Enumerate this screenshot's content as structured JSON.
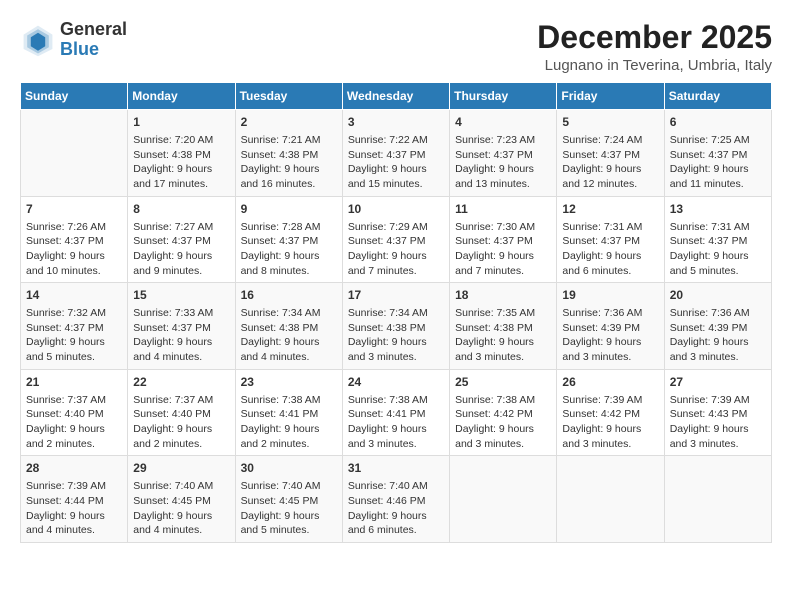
{
  "logo": {
    "general": "General",
    "blue": "Blue"
  },
  "title": "December 2025",
  "location": "Lugnano in Teverina, Umbria, Italy",
  "days_of_week": [
    "Sunday",
    "Monday",
    "Tuesday",
    "Wednesday",
    "Thursday",
    "Friday",
    "Saturday"
  ],
  "weeks": [
    [
      {
        "day": "",
        "content": ""
      },
      {
        "day": "1",
        "content": "Sunrise: 7:20 AM\nSunset: 4:38 PM\nDaylight: 9 hours\nand 17 minutes."
      },
      {
        "day": "2",
        "content": "Sunrise: 7:21 AM\nSunset: 4:38 PM\nDaylight: 9 hours\nand 16 minutes."
      },
      {
        "day": "3",
        "content": "Sunrise: 7:22 AM\nSunset: 4:37 PM\nDaylight: 9 hours\nand 15 minutes."
      },
      {
        "day": "4",
        "content": "Sunrise: 7:23 AM\nSunset: 4:37 PM\nDaylight: 9 hours\nand 13 minutes."
      },
      {
        "day": "5",
        "content": "Sunrise: 7:24 AM\nSunset: 4:37 PM\nDaylight: 9 hours\nand 12 minutes."
      },
      {
        "day": "6",
        "content": "Sunrise: 7:25 AM\nSunset: 4:37 PM\nDaylight: 9 hours\nand 11 minutes."
      }
    ],
    [
      {
        "day": "7",
        "content": "Sunrise: 7:26 AM\nSunset: 4:37 PM\nDaylight: 9 hours\nand 10 minutes."
      },
      {
        "day": "8",
        "content": "Sunrise: 7:27 AM\nSunset: 4:37 PM\nDaylight: 9 hours\nand 9 minutes."
      },
      {
        "day": "9",
        "content": "Sunrise: 7:28 AM\nSunset: 4:37 PM\nDaylight: 9 hours\nand 8 minutes."
      },
      {
        "day": "10",
        "content": "Sunrise: 7:29 AM\nSunset: 4:37 PM\nDaylight: 9 hours\nand 7 minutes."
      },
      {
        "day": "11",
        "content": "Sunrise: 7:30 AM\nSunset: 4:37 PM\nDaylight: 9 hours\nand 7 minutes."
      },
      {
        "day": "12",
        "content": "Sunrise: 7:31 AM\nSunset: 4:37 PM\nDaylight: 9 hours\nand 6 minutes."
      },
      {
        "day": "13",
        "content": "Sunrise: 7:31 AM\nSunset: 4:37 PM\nDaylight: 9 hours\nand 5 minutes."
      }
    ],
    [
      {
        "day": "14",
        "content": "Sunrise: 7:32 AM\nSunset: 4:37 PM\nDaylight: 9 hours\nand 5 minutes."
      },
      {
        "day": "15",
        "content": "Sunrise: 7:33 AM\nSunset: 4:37 PM\nDaylight: 9 hours\nand 4 minutes."
      },
      {
        "day": "16",
        "content": "Sunrise: 7:34 AM\nSunset: 4:38 PM\nDaylight: 9 hours\nand 4 minutes."
      },
      {
        "day": "17",
        "content": "Sunrise: 7:34 AM\nSunset: 4:38 PM\nDaylight: 9 hours\nand 3 minutes."
      },
      {
        "day": "18",
        "content": "Sunrise: 7:35 AM\nSunset: 4:38 PM\nDaylight: 9 hours\nand 3 minutes."
      },
      {
        "day": "19",
        "content": "Sunrise: 7:36 AM\nSunset: 4:39 PM\nDaylight: 9 hours\nand 3 minutes."
      },
      {
        "day": "20",
        "content": "Sunrise: 7:36 AM\nSunset: 4:39 PM\nDaylight: 9 hours\nand 3 minutes."
      }
    ],
    [
      {
        "day": "21",
        "content": "Sunrise: 7:37 AM\nSunset: 4:40 PM\nDaylight: 9 hours\nand 2 minutes."
      },
      {
        "day": "22",
        "content": "Sunrise: 7:37 AM\nSunset: 4:40 PM\nDaylight: 9 hours\nand 2 minutes."
      },
      {
        "day": "23",
        "content": "Sunrise: 7:38 AM\nSunset: 4:41 PM\nDaylight: 9 hours\nand 2 minutes."
      },
      {
        "day": "24",
        "content": "Sunrise: 7:38 AM\nSunset: 4:41 PM\nDaylight: 9 hours\nand 3 minutes."
      },
      {
        "day": "25",
        "content": "Sunrise: 7:38 AM\nSunset: 4:42 PM\nDaylight: 9 hours\nand 3 minutes."
      },
      {
        "day": "26",
        "content": "Sunrise: 7:39 AM\nSunset: 4:42 PM\nDaylight: 9 hours\nand 3 minutes."
      },
      {
        "day": "27",
        "content": "Sunrise: 7:39 AM\nSunset: 4:43 PM\nDaylight: 9 hours\nand 3 minutes."
      }
    ],
    [
      {
        "day": "28",
        "content": "Sunrise: 7:39 AM\nSunset: 4:44 PM\nDaylight: 9 hours\nand 4 minutes."
      },
      {
        "day": "29",
        "content": "Sunrise: 7:40 AM\nSunset: 4:45 PM\nDaylight: 9 hours\nand 4 minutes."
      },
      {
        "day": "30",
        "content": "Sunrise: 7:40 AM\nSunset: 4:45 PM\nDaylight: 9 hours\nand 5 minutes."
      },
      {
        "day": "31",
        "content": "Sunrise: 7:40 AM\nSunset: 4:46 PM\nDaylight: 9 hours\nand 6 minutes."
      },
      {
        "day": "",
        "content": ""
      },
      {
        "day": "",
        "content": ""
      },
      {
        "day": "",
        "content": ""
      }
    ]
  ]
}
